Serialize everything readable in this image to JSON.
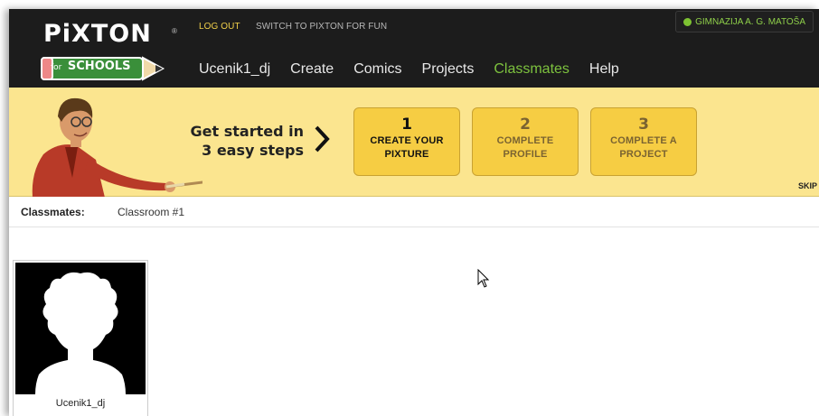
{
  "header": {
    "logo_text": "PiXTON",
    "logo_reg": "®",
    "logo_for": "for",
    "logo_schools": "SCHOOLS",
    "logout": "LOG OUT",
    "switch": "SWITCH TO PIXTON FOR FUN",
    "school": "GIMNAZIJA A. G. MATOŠA"
  },
  "nav": {
    "items": [
      "Ucenik1_dj",
      "Create",
      "Comics",
      "Projects",
      "Classmates",
      "Help"
    ],
    "active": "Classmates"
  },
  "banner": {
    "get_started_line1": "Get started in",
    "get_started_line2": "3 easy steps",
    "steps": [
      {
        "num": "1",
        "line1": "CREATE YOUR",
        "line2": "PIXTURE"
      },
      {
        "num": "2",
        "line1": "COMPLETE",
        "line2": "PROFILE"
      },
      {
        "num": "3",
        "line1": "COMPLETE A",
        "line2": "PROJECT"
      }
    ],
    "skip": "SKIP"
  },
  "classmates_bar": {
    "label": "Classmates:",
    "classroom": "Classroom #1"
  },
  "students": [
    {
      "name": "Ucenik1_dj"
    }
  ],
  "colors": {
    "header_bg": "#1c1c1c",
    "banner_bg": "#fbe58f",
    "step_bg": "#f6cd43",
    "nav_active": "#7dc23e",
    "logout": "#f1d04a"
  }
}
